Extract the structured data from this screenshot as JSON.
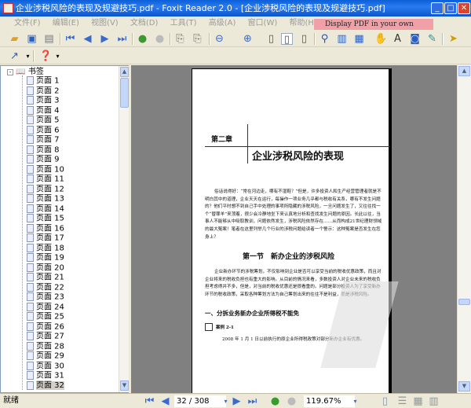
{
  "window": {
    "title": "企业涉税风险的表现及规避技巧.pdf - Foxit Reader 2.0 - [企业涉税风险的表现及规避技巧.pdf]"
  },
  "menu": [
    "文件(F)",
    "编辑(E)",
    "视图(V)",
    "文档(D)",
    "工具(T)",
    "高级(A)",
    "窗口(W)",
    "帮助(H)"
  ],
  "ad_banner": "Display PDF in your own applications",
  "sidebar": {
    "root": "书签",
    "items": [
      "页面 1",
      "页面 2",
      "页面 3",
      "页面 4",
      "页面 5",
      "页面 6",
      "页面 7",
      "页面 8",
      "页面 9",
      "页面 10",
      "页面 11",
      "页面 12",
      "页面 13",
      "页面 14",
      "页面 15",
      "页面 16",
      "页面 17",
      "页面 18",
      "页面 19",
      "页面 20",
      "页面 21",
      "页面 22",
      "页面 23",
      "页面 24",
      "页面 25",
      "页面 26",
      "页面 27",
      "页面 28",
      "页面 29",
      "页面 30",
      "页面 31",
      "页面 32"
    ],
    "selected": "页面 32"
  },
  "document": {
    "chapter": "第二章",
    "chapter_title": "企业涉税风险的表现",
    "intro": "俗话说得好：“常在河边走，哪有不湿鞋？”但是，许多投资人和生产经营管理者就是不明白其中的道理，企业天天在运行，每操作一项业务几乎都与税收有关系，哪有不发生问题的？他们平时想不到自己手中处理的事项所隐藏的涉税风险，一旦问题发生了，又往往找一个“替罪羊”来顶着，很少会冷静地坐下来认真地分析和查找发生问题的原因。长此以往，当事人不能够从中吸取教训，问题依然发生，涉税风险依然存在……从而构成21世纪理财领域的最大冤案！笔者在这里列举几个行业的涉税问题给读者一个警示：这种冤案是否发生在您身上？",
    "section": "第一节　新办企业的涉税风险",
    "section_text": "企业新办环节的涉税筹划，不仅影响到企业是否可以享受当前的税收优惠政策，而且对企业将来的税收负担也有重大的影响。从目前的情况来看，多数投资人对企业未来的税收负担考虑得并不多，但是，对当前的税收优惠还是很看重的。问题是部分投资人为了享受新办环节的税收政策，采取各种筹划方法为自己筹划出来的往往不是利益，而是涉税风险。",
    "subheading": "一、分拆业务新办企业所得税不能免",
    "case_label": "案例 2-1",
    "case_text": "2008 年 1 月 1 日以前执行的原企业所得税政策对部分新办企业有优惠。"
  },
  "status": {
    "text": "就绪",
    "page": "32 / 308",
    "zoom": "119.67%"
  }
}
